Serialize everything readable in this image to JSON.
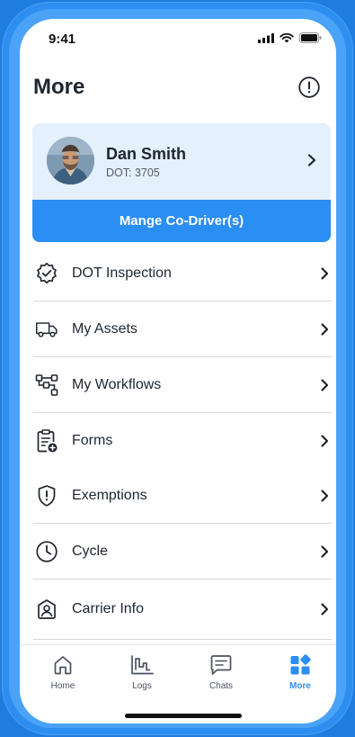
{
  "status": {
    "time": "9:41"
  },
  "header": {
    "title": "More"
  },
  "profile": {
    "name": "Dan Smith",
    "dot": "DOT: 3705",
    "action_label": "Mange Co-Driver(s)"
  },
  "menu": [
    {
      "label": "DOT Inspection",
      "icon": "badge-check-icon"
    },
    {
      "label": "My Assets",
      "icon": "truck-icon"
    },
    {
      "label": "My Workflows",
      "icon": "workflow-icon"
    },
    {
      "label": "Forms",
      "icon": "clipboard-add-icon"
    },
    {
      "label": "Exemptions",
      "icon": "shield-alert-icon"
    },
    {
      "label": "Cycle",
      "icon": "clock-icon"
    },
    {
      "label": "Carrier Info",
      "icon": "carrier-icon"
    }
  ],
  "tabs": [
    {
      "label": "Home",
      "icon": "home-icon"
    },
    {
      "label": "Logs",
      "icon": "logs-chart-icon"
    },
    {
      "label": "Chats",
      "icon": "chat-icon"
    },
    {
      "label": "More",
      "icon": "grid-icon",
      "active": true
    }
  ],
  "colors": {
    "accent": "#2a8ef4",
    "card_bg": "#e4f0fc",
    "frame": "#1f7de0"
  }
}
